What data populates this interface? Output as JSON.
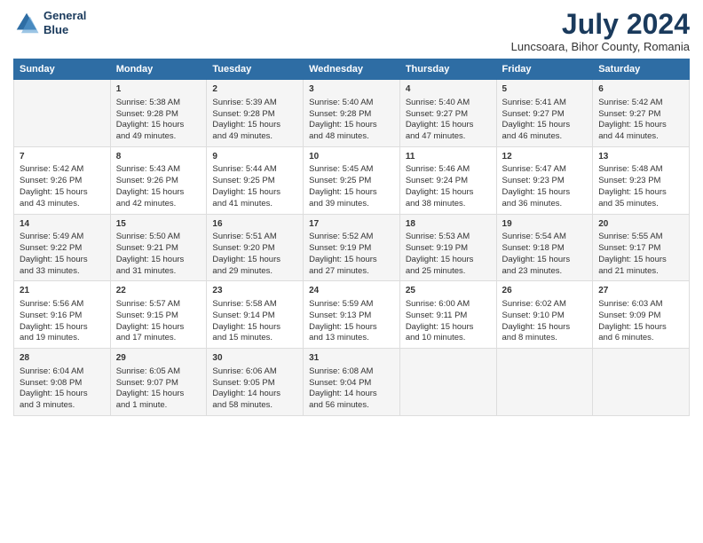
{
  "logo": {
    "line1": "General",
    "line2": "Blue"
  },
  "title": "July 2024",
  "subtitle": "Luncsoara, Bihor County, Romania",
  "days_of_week": [
    "Sunday",
    "Monday",
    "Tuesday",
    "Wednesday",
    "Thursday",
    "Friday",
    "Saturday"
  ],
  "weeks": [
    [
      {
        "day": "",
        "content": ""
      },
      {
        "day": "1",
        "content": "Sunrise: 5:38 AM\nSunset: 9:28 PM\nDaylight: 15 hours\nand 49 minutes."
      },
      {
        "day": "2",
        "content": "Sunrise: 5:39 AM\nSunset: 9:28 PM\nDaylight: 15 hours\nand 49 minutes."
      },
      {
        "day": "3",
        "content": "Sunrise: 5:40 AM\nSunset: 9:28 PM\nDaylight: 15 hours\nand 48 minutes."
      },
      {
        "day": "4",
        "content": "Sunrise: 5:40 AM\nSunset: 9:27 PM\nDaylight: 15 hours\nand 47 minutes."
      },
      {
        "day": "5",
        "content": "Sunrise: 5:41 AM\nSunset: 9:27 PM\nDaylight: 15 hours\nand 46 minutes."
      },
      {
        "day": "6",
        "content": "Sunrise: 5:42 AM\nSunset: 9:27 PM\nDaylight: 15 hours\nand 44 minutes."
      }
    ],
    [
      {
        "day": "7",
        "content": "Sunrise: 5:42 AM\nSunset: 9:26 PM\nDaylight: 15 hours\nand 43 minutes."
      },
      {
        "day": "8",
        "content": "Sunrise: 5:43 AM\nSunset: 9:26 PM\nDaylight: 15 hours\nand 42 minutes."
      },
      {
        "day": "9",
        "content": "Sunrise: 5:44 AM\nSunset: 9:25 PM\nDaylight: 15 hours\nand 41 minutes."
      },
      {
        "day": "10",
        "content": "Sunrise: 5:45 AM\nSunset: 9:25 PM\nDaylight: 15 hours\nand 39 minutes."
      },
      {
        "day": "11",
        "content": "Sunrise: 5:46 AM\nSunset: 9:24 PM\nDaylight: 15 hours\nand 38 minutes."
      },
      {
        "day": "12",
        "content": "Sunrise: 5:47 AM\nSunset: 9:23 PM\nDaylight: 15 hours\nand 36 minutes."
      },
      {
        "day": "13",
        "content": "Sunrise: 5:48 AM\nSunset: 9:23 PM\nDaylight: 15 hours\nand 35 minutes."
      }
    ],
    [
      {
        "day": "14",
        "content": "Sunrise: 5:49 AM\nSunset: 9:22 PM\nDaylight: 15 hours\nand 33 minutes."
      },
      {
        "day": "15",
        "content": "Sunrise: 5:50 AM\nSunset: 9:21 PM\nDaylight: 15 hours\nand 31 minutes."
      },
      {
        "day": "16",
        "content": "Sunrise: 5:51 AM\nSunset: 9:20 PM\nDaylight: 15 hours\nand 29 minutes."
      },
      {
        "day": "17",
        "content": "Sunrise: 5:52 AM\nSunset: 9:19 PM\nDaylight: 15 hours\nand 27 minutes."
      },
      {
        "day": "18",
        "content": "Sunrise: 5:53 AM\nSunset: 9:19 PM\nDaylight: 15 hours\nand 25 minutes."
      },
      {
        "day": "19",
        "content": "Sunrise: 5:54 AM\nSunset: 9:18 PM\nDaylight: 15 hours\nand 23 minutes."
      },
      {
        "day": "20",
        "content": "Sunrise: 5:55 AM\nSunset: 9:17 PM\nDaylight: 15 hours\nand 21 minutes."
      }
    ],
    [
      {
        "day": "21",
        "content": "Sunrise: 5:56 AM\nSunset: 9:16 PM\nDaylight: 15 hours\nand 19 minutes."
      },
      {
        "day": "22",
        "content": "Sunrise: 5:57 AM\nSunset: 9:15 PM\nDaylight: 15 hours\nand 17 minutes."
      },
      {
        "day": "23",
        "content": "Sunrise: 5:58 AM\nSunset: 9:14 PM\nDaylight: 15 hours\nand 15 minutes."
      },
      {
        "day": "24",
        "content": "Sunrise: 5:59 AM\nSunset: 9:13 PM\nDaylight: 15 hours\nand 13 minutes."
      },
      {
        "day": "25",
        "content": "Sunrise: 6:00 AM\nSunset: 9:11 PM\nDaylight: 15 hours\nand 10 minutes."
      },
      {
        "day": "26",
        "content": "Sunrise: 6:02 AM\nSunset: 9:10 PM\nDaylight: 15 hours\nand 8 minutes."
      },
      {
        "day": "27",
        "content": "Sunrise: 6:03 AM\nSunset: 9:09 PM\nDaylight: 15 hours\nand 6 minutes."
      }
    ],
    [
      {
        "day": "28",
        "content": "Sunrise: 6:04 AM\nSunset: 9:08 PM\nDaylight: 15 hours\nand 3 minutes."
      },
      {
        "day": "29",
        "content": "Sunrise: 6:05 AM\nSunset: 9:07 PM\nDaylight: 15 hours\nand 1 minute."
      },
      {
        "day": "30",
        "content": "Sunrise: 6:06 AM\nSunset: 9:05 PM\nDaylight: 14 hours\nand 58 minutes."
      },
      {
        "day": "31",
        "content": "Sunrise: 6:08 AM\nSunset: 9:04 PM\nDaylight: 14 hours\nand 56 minutes."
      },
      {
        "day": "",
        "content": ""
      },
      {
        "day": "",
        "content": ""
      },
      {
        "day": "",
        "content": ""
      }
    ]
  ]
}
